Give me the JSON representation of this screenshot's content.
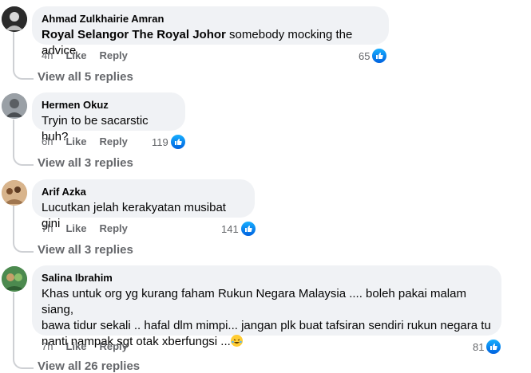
{
  "comments": [
    {
      "name": "Ahmad Zulkhairie Amran",
      "mention": "Royal Selangor The Royal Johor",
      "text": " somebody mocking the advice",
      "time": "4h",
      "like_label": "Like",
      "reply_label": "Reply",
      "likes": "65",
      "view_replies": "View all 5 replies"
    },
    {
      "name": "Hermen Okuz",
      "text": "Tryin to be sacarstic huh?",
      "time": "6h",
      "like_label": "Like",
      "reply_label": "Reply",
      "likes": "119",
      "view_replies": "View all 3 replies"
    },
    {
      "name": "Arif Azka",
      "text": "Lucutkan jelah kerakyatan musibat gini",
      "time": "7h",
      "like_label": "Like",
      "reply_label": "Reply",
      "likes": "141",
      "view_replies": "View all 3 replies"
    },
    {
      "name": "Salina Ibrahim",
      "text_lines": [
        "Khas untuk org yg kurang faham Rukun Negara Malaysia .... boleh pakai malam siang,",
        "bawa tidur sekali .. hafal dlm mimpi... jangan plk buat tafsiran sendiri rukun negara tu",
        "nanti nampak sgt otak xberfungsi ..."
      ],
      "emoji": "rolling-on-floor-laughing-emoji",
      "time": "7h",
      "like_label": "Like",
      "reply_label": "Reply",
      "likes": "81",
      "view_replies": "View all 26 replies"
    }
  ],
  "colors": {
    "bubble": "#f0f2f5",
    "meta": "#65676b",
    "like_blue": "#0866ff"
  }
}
